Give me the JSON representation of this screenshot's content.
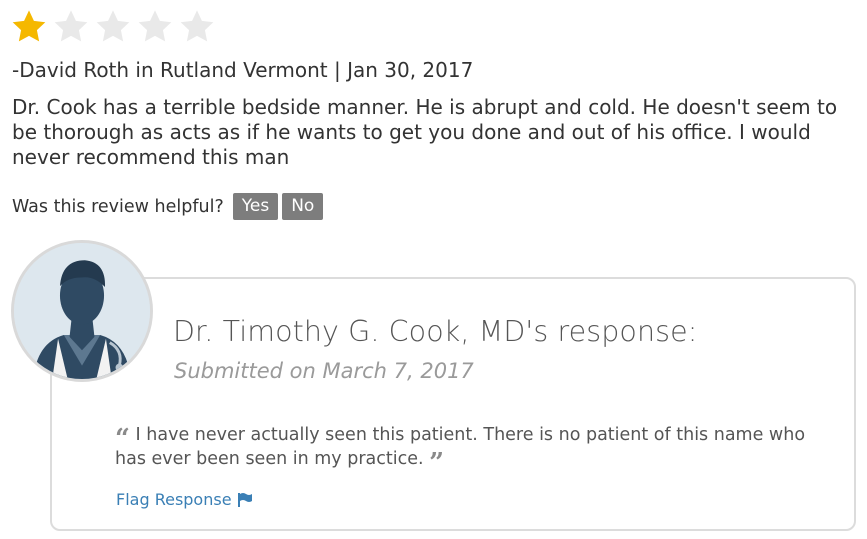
{
  "rating": {
    "filled": 1,
    "total": 5,
    "filled_color": "#f5b800",
    "empty_color": "#e9e9e9"
  },
  "review": {
    "byline": "-David Roth in Rutland Vermont | Jan 30, 2017",
    "text": "Dr. Cook has a terrible bedside manner. He is abrupt and cold. He doesn't seem to be thorough as acts as if he wants to get you done and out of his office. I would never recommend this man"
  },
  "helpful": {
    "question": "Was this review helpful?",
    "yes_label": "Yes",
    "no_label": "No"
  },
  "response": {
    "title": "Dr. Timothy G. Cook, MD's response:",
    "submitted": "Submitted on March 7, 2017",
    "text": "I have never actually seen this patient. There is no patient of this name who has ever been seen in my practice.",
    "flag_label": "Flag Response",
    "icons": {
      "avatar": "doctor-avatar-icon",
      "open_quote": "open-quote-icon",
      "close_quote": "close-quote-icon",
      "flag": "flag-icon"
    },
    "link_color": "#3a7fb5"
  }
}
